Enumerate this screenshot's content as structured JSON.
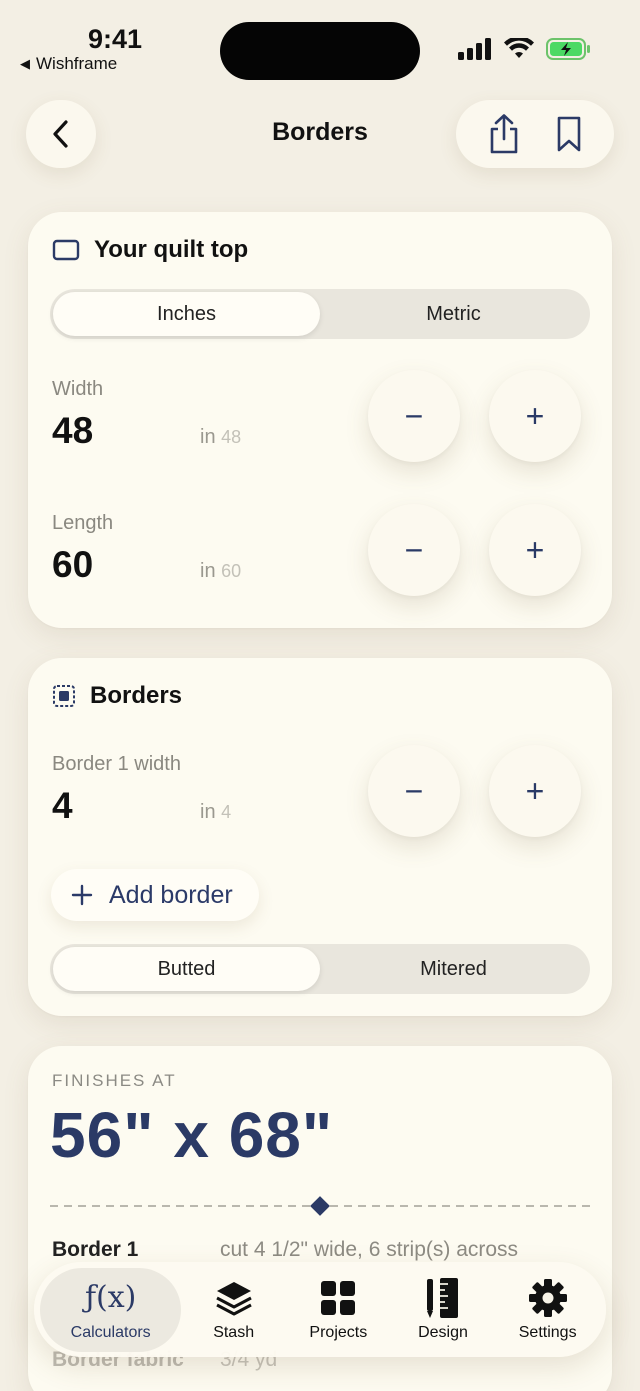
{
  "status": {
    "time": "9:41",
    "back_app": "Wishframe"
  },
  "nav": {
    "title": "Borders",
    "back_icon": "chevron-left-icon",
    "share_icon": "share-icon",
    "bookmark_icon": "bookmark-icon"
  },
  "quilt_top": {
    "title": "Your quilt top",
    "units": {
      "options": [
        "Inches",
        "Metric"
      ],
      "selected": "Inches"
    },
    "width": {
      "label": "Width",
      "value": "48",
      "unit": "in",
      "hint": "48"
    },
    "length": {
      "label": "Length",
      "value": "60",
      "unit": "in",
      "hint": "60"
    },
    "minus": "−",
    "plus": "+"
  },
  "borders": {
    "title": "Borders",
    "border1": {
      "label": "Border 1 width",
      "value": "4",
      "unit": "in",
      "hint": "4"
    },
    "add_border": "Add border",
    "style": {
      "options": [
        "Butted",
        "Mitered"
      ],
      "selected": "Butted"
    },
    "minus": "−",
    "plus": "+"
  },
  "finishes": {
    "label": "FINISHES AT",
    "value": "56\" x 68\"",
    "rows": [
      {
        "label": "Border 1",
        "detail": "cut 4 1/2\" wide, 6 strip(s) across"
      },
      {
        "label": "Border fabric",
        "detail": "3/4 yd"
      }
    ]
  },
  "tabbar": {
    "tabs": [
      {
        "label": "Calculators",
        "icon": "function-icon",
        "active": true
      },
      {
        "label": "Stash",
        "icon": "layers-icon",
        "active": false
      },
      {
        "label": "Projects",
        "icon": "grid-icon",
        "active": false
      },
      {
        "label": "Design",
        "icon": "ruler-pencil-icon",
        "active": false
      },
      {
        "label": "Settings",
        "icon": "gear-icon",
        "active": false
      }
    ]
  },
  "colors": {
    "background": "#f3efe4",
    "card": "#fdfbf1",
    "accent": "#2b3a66",
    "battery": "#4cd964"
  }
}
